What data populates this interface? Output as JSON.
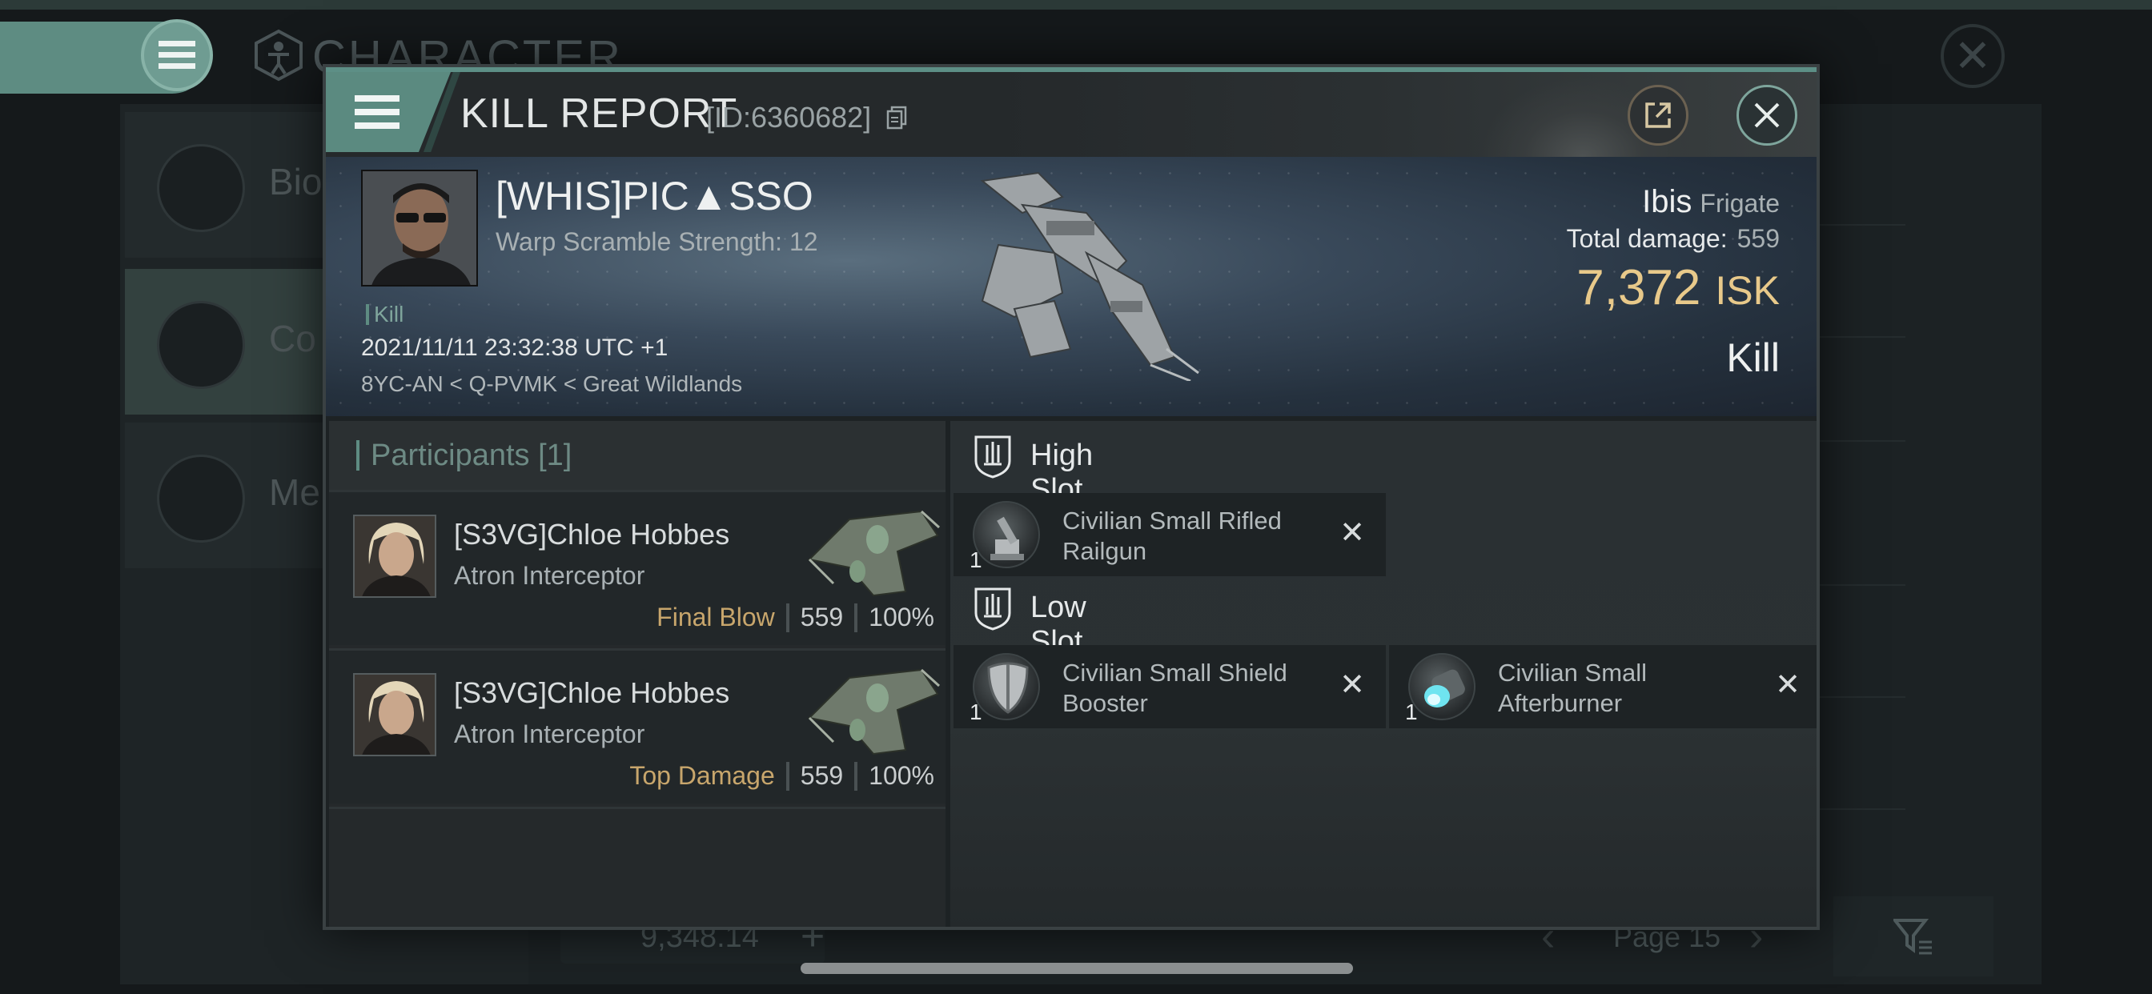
{
  "background": {
    "title": "CHARACTER",
    "side_items": [
      "Bio",
      "Co",
      "Me"
    ],
    "wallet_value": "9,348.14",
    "page_label": "Page 15"
  },
  "modal": {
    "title": "KILL REPORT",
    "id_label": "[ID:6360682]"
  },
  "victim": {
    "name": "[WHIS]PIC▲SSO",
    "warp_scramble": "Warp Scramble Strength: 12",
    "kill_tag": "Kill",
    "datetime": "2021/11/11 23:32:38 UTC +1",
    "location": "8YC-AN < Q-PVMK < Great Wildlands",
    "ship_name": "Ibis",
    "ship_class": "Frigate",
    "total_damage_label": "Total damage:",
    "total_damage": "559",
    "isk_value": "7,372",
    "isk_unit": "ISK",
    "result": "Kill"
  },
  "participants": {
    "header": "Participants [1]",
    "list": [
      {
        "name": "[S3VG]Chloe Hobbes",
        "ship": "Atron Interceptor",
        "tag": "Final Blow",
        "damage": "559",
        "percent": "100%"
      },
      {
        "name": "[S3VG]Chloe Hobbes",
        "ship": "Atron Interceptor",
        "tag": "Top Damage",
        "damage": "559",
        "percent": "100%"
      }
    ]
  },
  "fitting": {
    "high_slot": {
      "title": "High Slot",
      "modules": [
        {
          "qty": "1",
          "name": "Civilian Small Rifled Railgun",
          "icon": "railgun-icon"
        }
      ]
    },
    "low_slot": {
      "title": "Low Slot",
      "modules": [
        {
          "qty": "1",
          "name": "Civilian Small Shield Booster",
          "icon": "shield-booster-icon"
        },
        {
          "qty": "1",
          "name": "Civilian Small Afterburner",
          "icon": "afterburner-icon"
        }
      ]
    },
    "remove_glyph": "✕"
  },
  "colors": {
    "accent_teal": "#5e8c82",
    "isk_gold": "#e8c98a",
    "tag_gold": "#c8a66c"
  }
}
